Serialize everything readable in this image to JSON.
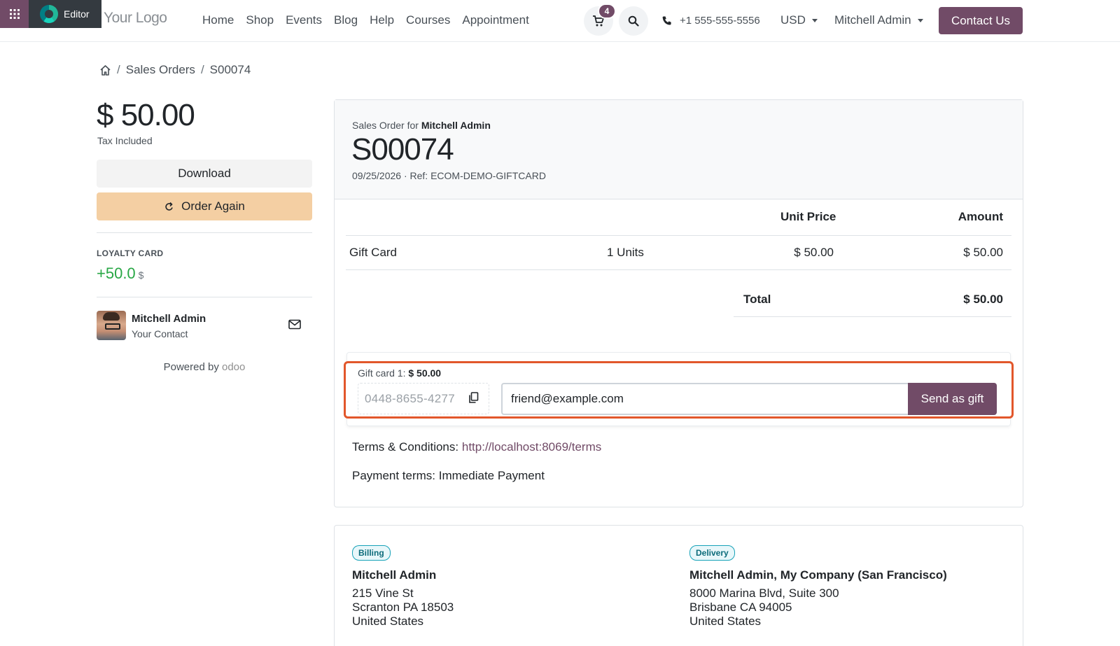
{
  "editor": {
    "label": "Editor"
  },
  "site": {
    "logo_text": "Your Logo"
  },
  "nav": {
    "items": [
      "Home",
      "Shop",
      "Events",
      "Blog",
      "Help",
      "Courses",
      "Appointment"
    ]
  },
  "header": {
    "cart_count": "4",
    "phone": "+1 555-555-5556",
    "currency": "USD",
    "user": "Mitchell Admin",
    "contact_button": "Contact Us"
  },
  "breadcrumb": {
    "sep": "/",
    "items": [
      "Sales Orders",
      "S00074"
    ]
  },
  "sidebar": {
    "amount": "$ 50.00",
    "tax_note": "Tax Included",
    "download": "Download",
    "order_again": "Order Again",
    "loyalty_label": "LOYALTY CARD",
    "loyalty_value": "+50.0",
    "loyalty_currency": "$",
    "contact_name": "Mitchell Admin",
    "contact_role": "Your Contact",
    "powered_by": "Powered by",
    "powered_brand": "odoo"
  },
  "order": {
    "for_label": "Sales Order for",
    "customer": "Mitchell Admin",
    "number": "S00074",
    "meta": "09/25/2026 · Ref: ECOM-DEMO-GIFTCARD",
    "columns": {
      "unit_price": "Unit Price",
      "amount": "Amount"
    },
    "line": {
      "product": "Gift Card",
      "qty": "1 Units",
      "unit_price": "$ 50.00",
      "amount": "$ 50.00"
    },
    "total_label": "Total",
    "total_value": "$ 50.00",
    "gift": {
      "title": "Gift card 1:",
      "title_amount": "$ 50.00",
      "code": "0448-8655-4277",
      "email": "friend@example.com",
      "send_label": "Send as gift"
    },
    "terms_label": "Terms & Conditions:",
    "terms_link": "http://localhost:8069/terms",
    "payment_terms": "Payment terms: Immediate Payment"
  },
  "addresses": {
    "billing": {
      "badge": "Billing",
      "name": "Mitchell Admin",
      "lines": [
        "215 Vine St",
        "Scranton PA 18503",
        "United States"
      ]
    },
    "delivery": {
      "badge": "Delivery",
      "name": "Mitchell Admin, My Company (San Francisco)",
      "lines": [
        "8000 Marina Blvd, Suite 300",
        "Brisbane CA 94005",
        "United States"
      ]
    }
  },
  "colors": {
    "brand": "#714b67",
    "highlight": "#e2572b",
    "order_again_bg": "#f4cfa3",
    "loyalty_green": "#28a745"
  }
}
